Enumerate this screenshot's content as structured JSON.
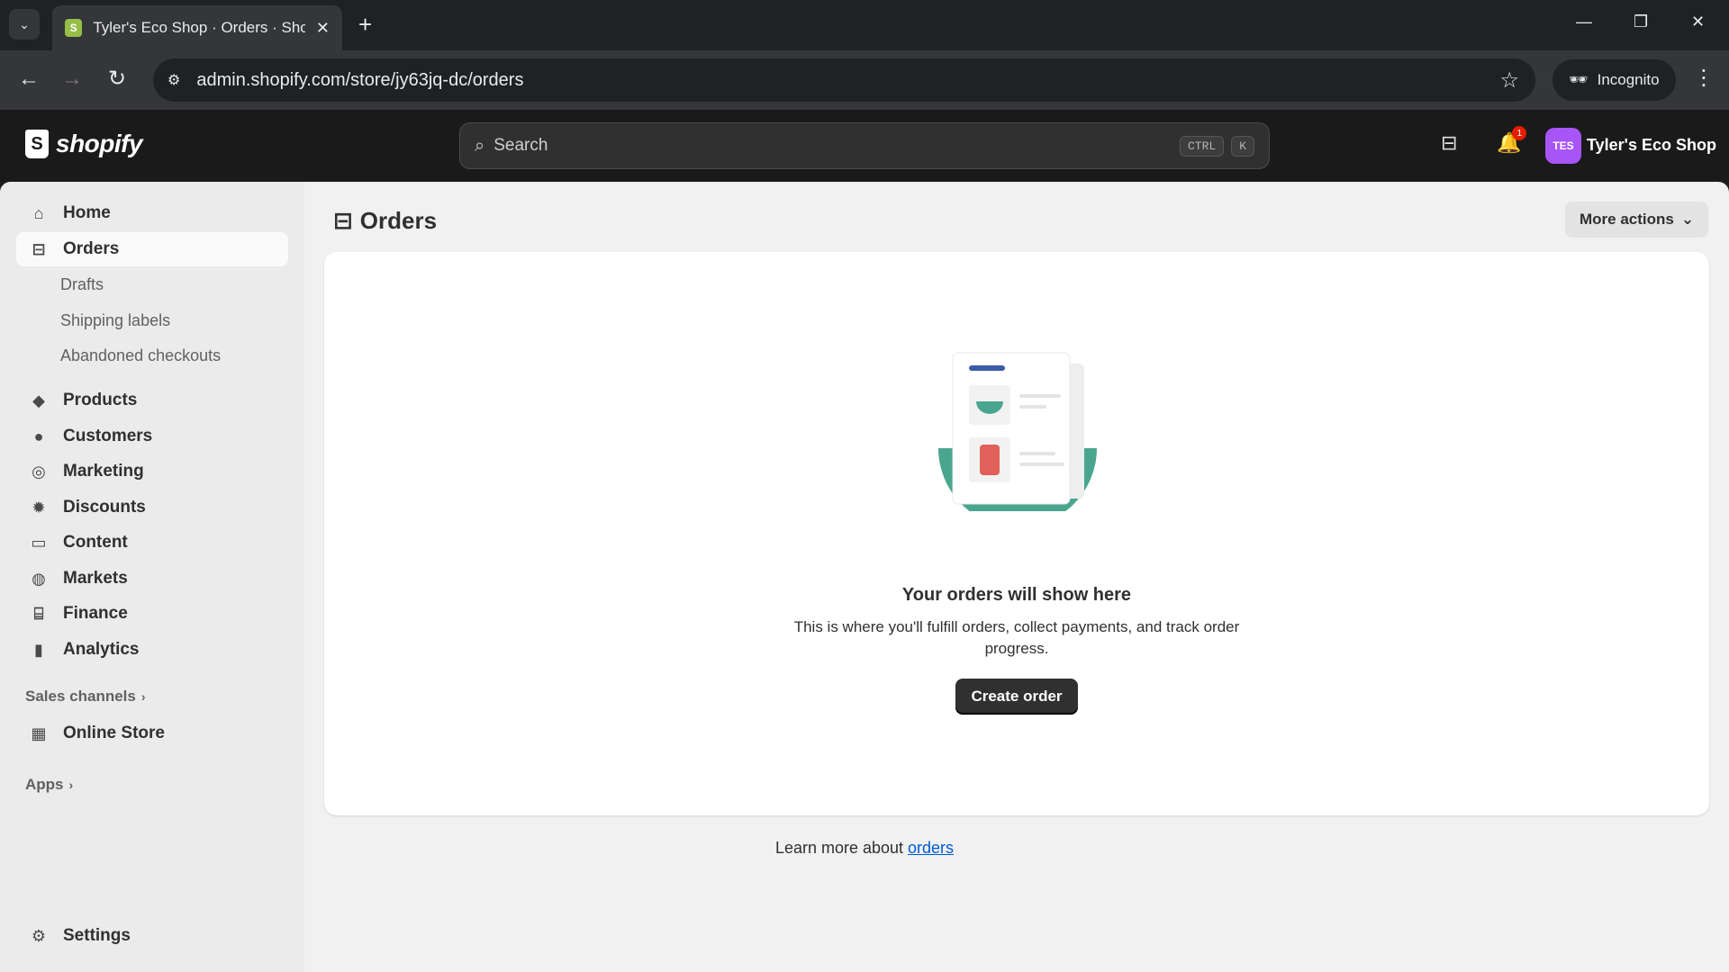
{
  "browser": {
    "tab_title": "Tyler's Eco Shop · Orders · Shop",
    "url": "admin.shopify.com/store/jy63jq-dc/orders",
    "incognito_label": "Incognito"
  },
  "topbar": {
    "logo_text": "shopify",
    "search_placeholder": "Search",
    "shortcut_key1": "CTRL",
    "shortcut_key2": "K",
    "notification_count": "1",
    "store_initials": "TES",
    "store_name": "Tyler's Eco Shop"
  },
  "sidebar": {
    "home": "Home",
    "orders": "Orders",
    "orders_sub": [
      "Drafts",
      "Shipping labels",
      "Abandoned checkouts"
    ],
    "products": "Products",
    "customers": "Customers",
    "marketing": "Marketing",
    "discounts": "Discounts",
    "content": "Content",
    "markets": "Markets",
    "finance": "Finance",
    "analytics": "Analytics",
    "sales_channels": "Sales channels",
    "online_store": "Online Store",
    "apps": "Apps",
    "settings": "Settings"
  },
  "main": {
    "title": "Orders",
    "more_actions": "More actions",
    "empty_title": "Your orders will show here",
    "empty_desc": "This is where you'll fulfill orders, collect payments, and track order progress.",
    "create_button": "Create order",
    "learn_prefix": "Learn more about ",
    "learn_link": "orders"
  },
  "colors": {
    "accent_link": "#005bd3",
    "illustration_teal": "#4aa58e",
    "illustration_red": "#e0605a",
    "illustration_blue": "#3b5ba9"
  }
}
